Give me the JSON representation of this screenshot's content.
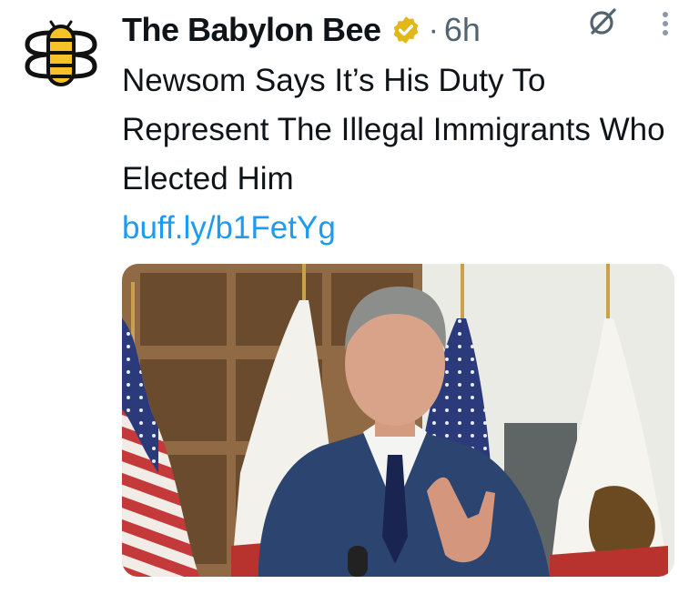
{
  "tweet": {
    "author": "The Babylon Bee",
    "separator": "·",
    "time": "6h",
    "text": "Newsom Says It’s His Duty To Represent The Illegal Immigrants Who Elected Him",
    "link": "buff.ly/b1FetYg"
  },
  "icons": {
    "avatar": "babylon-bee-logo",
    "verified": "gold-verified-badge",
    "grok": "grok-icon",
    "more": "more-vertical-icon"
  },
  "colors": {
    "link": "#1d9bf0",
    "secondary_text": "#536471",
    "verified_gold": "#e2b719",
    "bee_yellow": "#f7c12a"
  }
}
